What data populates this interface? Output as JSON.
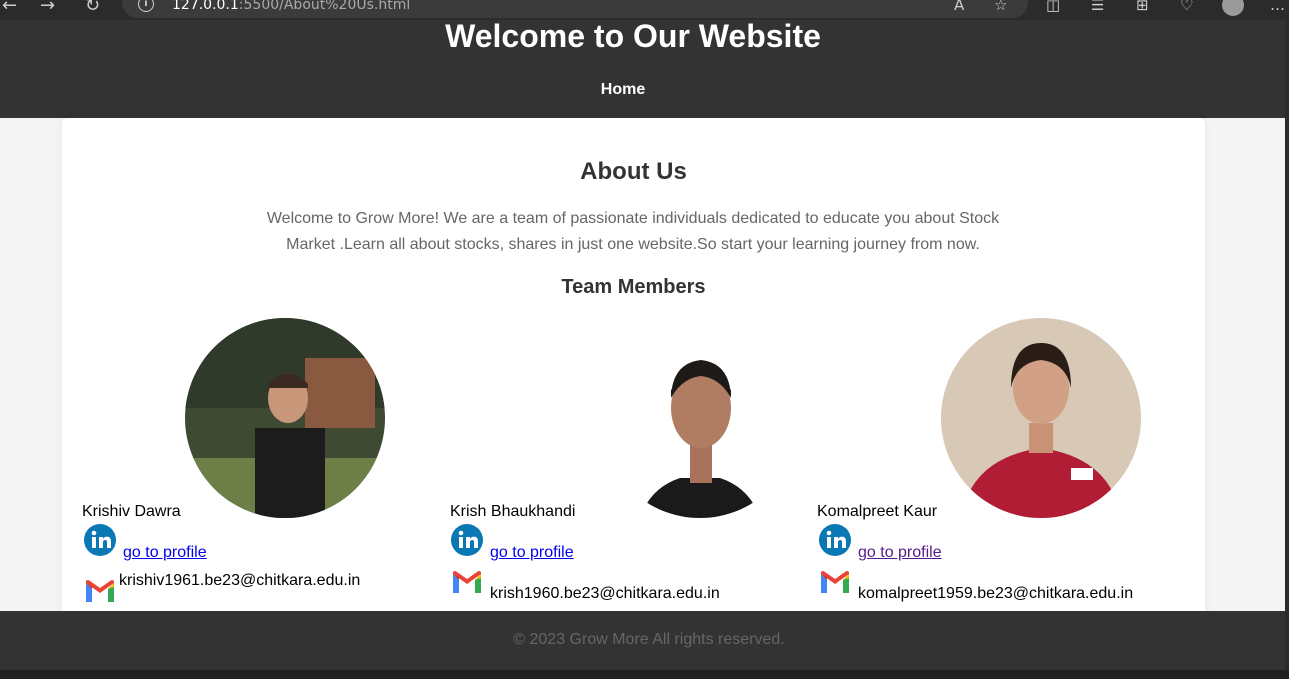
{
  "browser": {
    "url_host": "127.0.0.1",
    "url_path": ":5500/About%20Us.html",
    "icons": [
      "back-icon",
      "forward-icon",
      "refresh-icon",
      "info-icon",
      "read-aloud-icon",
      "favorite-icon",
      "split-screen-icon",
      "favorites-list-icon",
      "collections-icon",
      "extensions-icon",
      "profile-icon",
      "more-icon"
    ]
  },
  "header": {
    "title": "Welcome to Our Website",
    "nav_home": "Home"
  },
  "about": {
    "heading": "About Us",
    "intro": "Welcome to Grow More! We are a team of passionate individuals dedicated to educate you about Stock Market .Learn all about stocks, shares in just one website.So start your learning journey from now.",
    "team_heading": "Team Members"
  },
  "members": [
    {
      "name": "Krishiv Dawra",
      "profile_link": "go to profile",
      "email": "krishiv1961.be23@chitkara.edu.in"
    },
    {
      "name": "Krish Bhaukhandi",
      "profile_link": "go to profile",
      "email": "krish1960.be23@chitkara.edu.in"
    },
    {
      "name": "Komalpreet Kaur",
      "profile_link": "go to profile",
      "email": "komalpreet1959.be23@chitkara.edu.in"
    }
  ],
  "footer": {
    "text": "© 2023 Grow More All rights reserved."
  },
  "colors": {
    "header_bg": "#333333",
    "page_bg": "#f4f4f4",
    "link": "#0000ee",
    "link_visited": "#551a8b",
    "linkedin_blue": "#0a78b5"
  }
}
